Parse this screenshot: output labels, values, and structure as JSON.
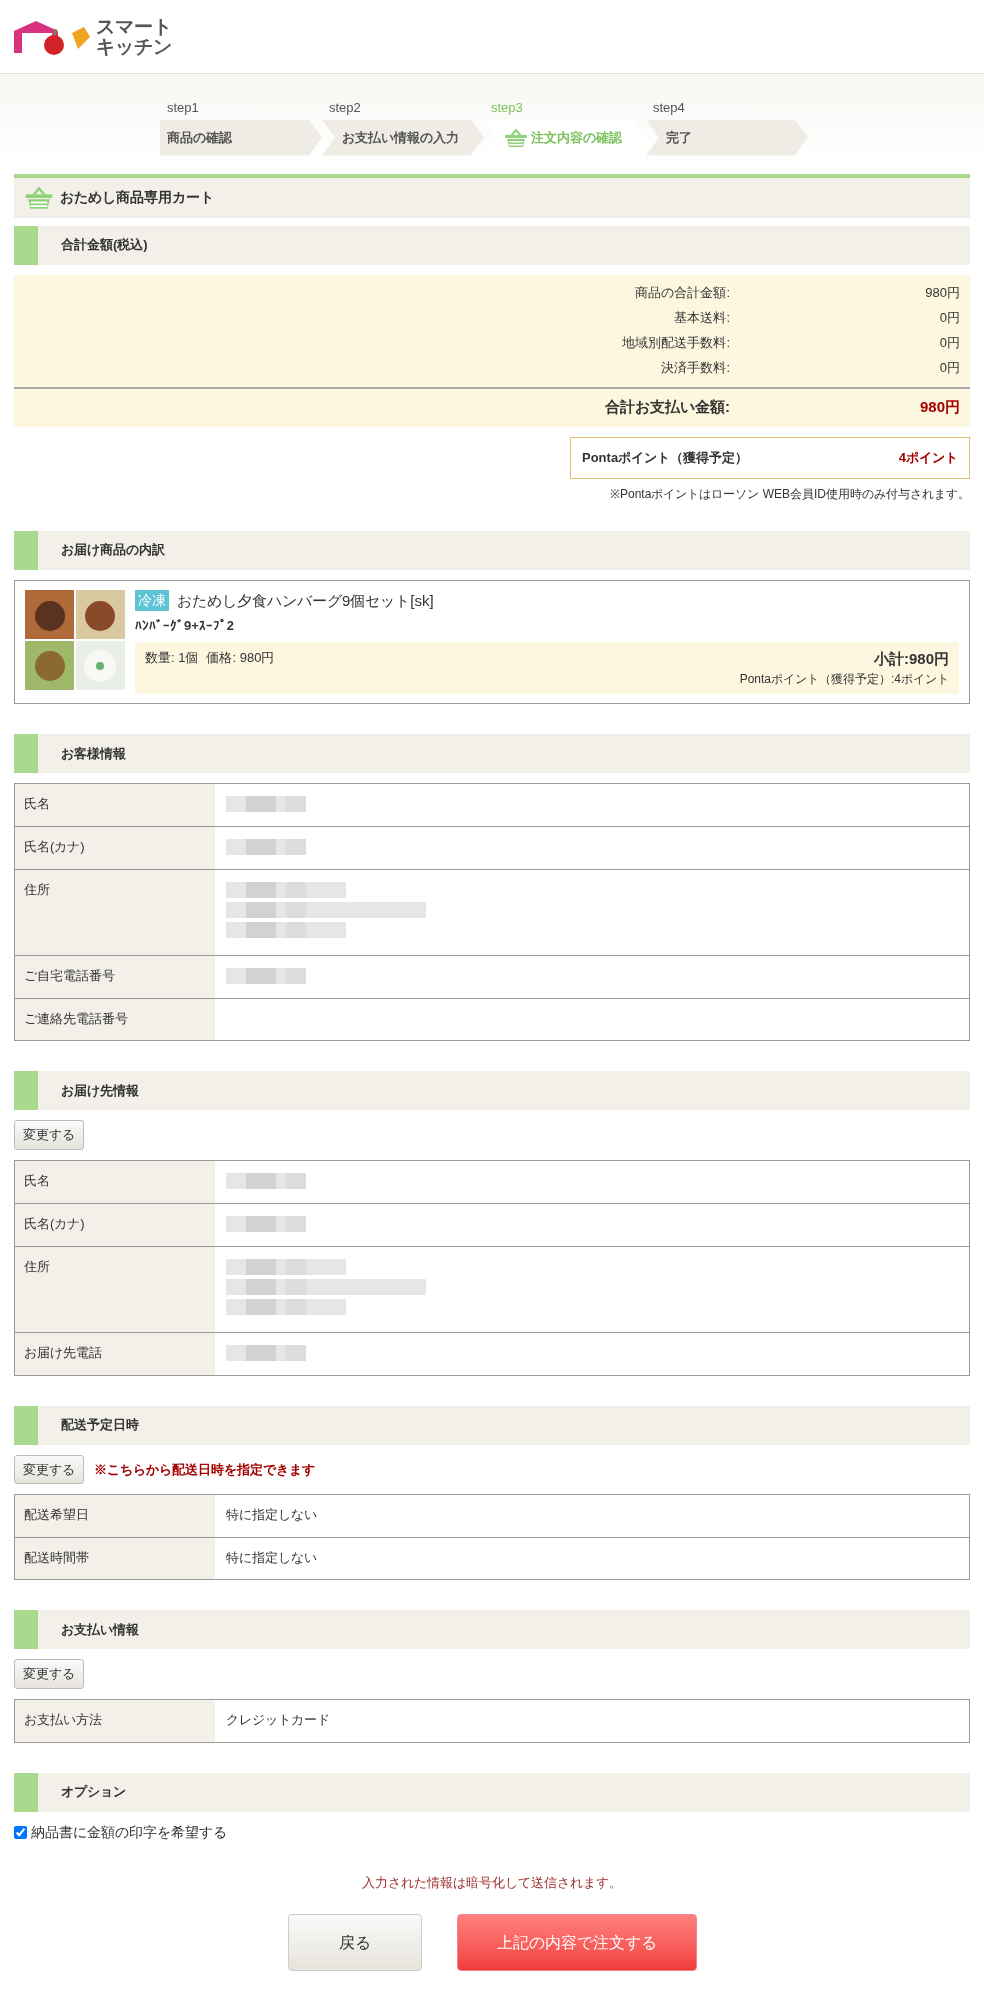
{
  "logo": {
    "lines": [
      "スマート",
      "キッチン"
    ]
  },
  "steps": [
    {
      "step": "step1",
      "label": "商品の確認",
      "selected": false
    },
    {
      "step": "step2",
      "label": "お支払い情報の入力",
      "selected": false
    },
    {
      "step": "step3",
      "label": "注文内容の確認",
      "selected": true
    },
    {
      "step": "step4",
      "label": "完了",
      "selected": false
    }
  ],
  "cart_title": "おためし商品専用カート",
  "totals": {
    "title": "合計金額(税込)",
    "rows": [
      {
        "label": "商品の合計金額:",
        "value": "980円"
      },
      {
        "label": "基本送料:",
        "value": "0円"
      },
      {
        "label": "地域別配送手数料:",
        "value": "0円"
      },
      {
        "label": "決済手数料:",
        "value": "0円"
      }
    ],
    "total": {
      "label": "合計お支払い金額:",
      "value": "980円"
    },
    "ponta": {
      "label": "Pontaポイント（獲得予定）",
      "value": "4ポイント"
    },
    "note": "※Pontaポイントはローソン WEB会員ID使用時のみ付与されます。"
  },
  "items_section": {
    "title": "お届け商品の内訳",
    "items": [
      {
        "badge": "冷凍",
        "name": "おためし夕食ハンバーグ9個セット[sk]",
        "sub": "ﾊﾝﾊﾞｰｸﾞ9+ｽｰﾌﾟ2",
        "quantity": "数量: 1個",
        "price": "価格: 980円",
        "subtotal": "小計:980円",
        "points": "Pontaポイント（獲得予定）:4ポイント"
      }
    ]
  },
  "info_sections": [
    {
      "title": "お客様情報",
      "rows": [
        {
          "label": "氏名",
          "kind": "redacted"
        },
        {
          "label": "氏名(カナ)",
          "kind": "redacted"
        },
        {
          "label": "住所",
          "kind": "redacted_multiline"
        },
        {
          "label": "ご自宅電話番号",
          "kind": "redacted"
        },
        {
          "label": "ご連絡先電話番号",
          "kind": "empty"
        }
      ]
    },
    {
      "title": "お届け先情報",
      "change_button": "変更する",
      "rows": [
        {
          "label": "氏名",
          "kind": "redacted"
        },
        {
          "label": "氏名(カナ)",
          "kind": "redacted"
        },
        {
          "label": "住所",
          "kind": "redacted_multiline"
        },
        {
          "label": "お届け先電話",
          "kind": "redacted"
        }
      ]
    },
    {
      "title": "配送予定日時",
      "change_button": "変更する",
      "notice": "※こちらから配送日時を指定できます",
      "rows": [
        {
          "label": "配送希望日",
          "kind": "text",
          "value": "特に指定しない"
        },
        {
          "label": "配送時間帯",
          "kind": "text",
          "value": "特に指定しない"
        }
      ]
    },
    {
      "title": "お支払い情報",
      "change_button": "変更する",
      "rows": [
        {
          "label": "お支払い方法",
          "kind": "text",
          "value": "クレジットカード"
        }
      ]
    }
  ],
  "options": {
    "title": "オプション",
    "items": [
      {
        "label": "納品書に金額の印字を希望する",
        "checked": true
      }
    ]
  },
  "security_note": "入力された情報は暗号化して送信されます。",
  "buttons": {
    "back": "戻る",
    "order": "上記の内容で注文する"
  }
}
